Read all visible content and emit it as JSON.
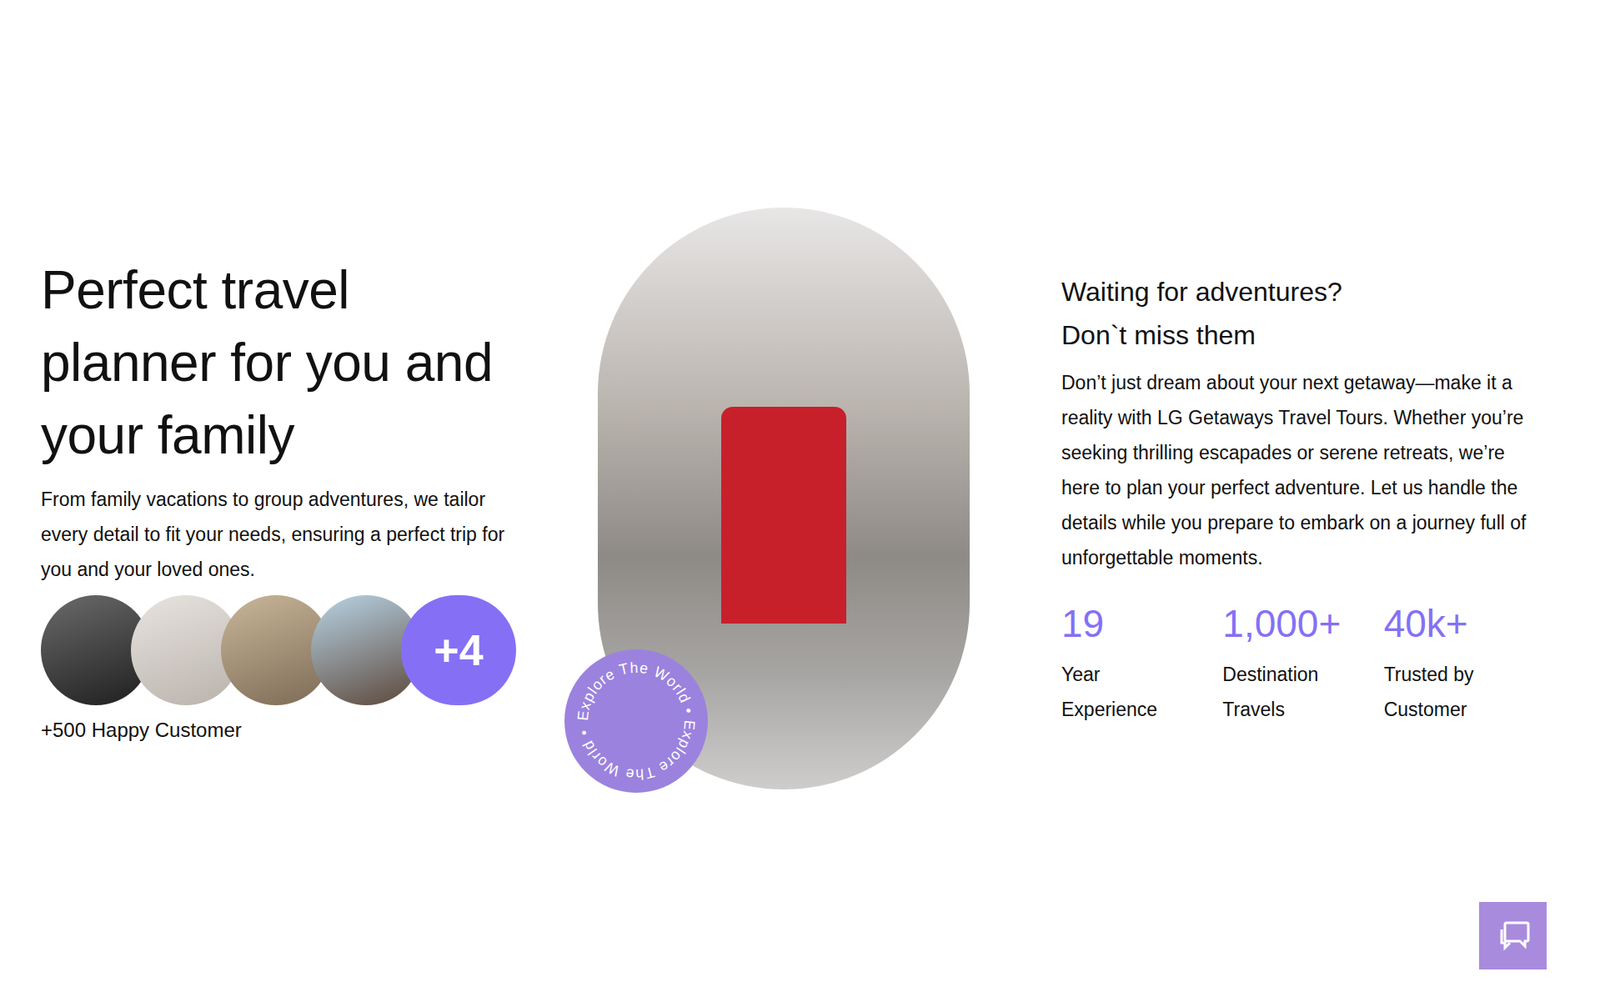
{
  "hero": {
    "title": "Perfect travel planner for you and your family",
    "description": "From family vacations to group adventures, we tailor every detail to fit your needs, ensuring a perfect trip for you and your loved ones.",
    "avatars_more": "+4",
    "customers": "+500 Happy Customer"
  },
  "badge": {
    "text": "Explore The World • Explore The World •"
  },
  "info": {
    "heading_lines": [
      "Waiting for adventures?",
      "Don`t miss them"
    ],
    "paragraph": "Don’t just dream about your next getaway—make it a reality with LG Getaways Travel Tours. Whether you’re seeking thrilling escapades or serene retreats, we’re here to plan your perfect adventure. Let us handle the details while you prepare to embark on a journey full of unforgettable moments.",
    "stats": [
      {
        "value": "19",
        "label": "Year Experience"
      },
      {
        "value": "1,000+",
        "label": "Destination Travels"
      },
      {
        "value": "40k+",
        "label": "Trusted by Customer"
      }
    ]
  }
}
